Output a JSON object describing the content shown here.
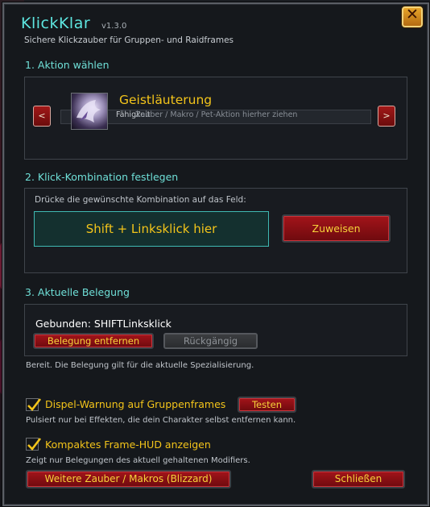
{
  "window": {
    "title": "KlickKlar",
    "version": "v1.3.0",
    "subtitle": "Sichere Klickzauber für Gruppen- und Raidframes",
    "close_label": "✕"
  },
  "section1": {
    "heading": "1. Aktion wählen",
    "prev_label": "<",
    "next_label": ">",
    "spell_name": "Geistläuterung",
    "spell_sub": "Fähigkeit",
    "drop_hint": "Zauber / Makro / Pet-Aktion hierher ziehen",
    "spell_icon": "spell-icon"
  },
  "section2": {
    "heading": "2. Klick-Kombination festlegen",
    "instruction": "Drücke die gewünschte Kombination auf das Feld:",
    "combo_field": "Shift + Linksklick hier",
    "assign_label": "Zuweisen"
  },
  "section3": {
    "heading": "3. Aktuelle Belegung",
    "bound_text": "Gebunden: SHIFTLinksklick",
    "remove_label": "Belegung entfernen",
    "undo_label": "Rückgängig"
  },
  "status_text": "Bereit. Die Belegung gilt für die aktuelle Spezialisierung.",
  "options": {
    "dispel": {
      "label": "Dispel-Warnung auf Gruppenframes",
      "checked": true,
      "test_label": "Testen",
      "description": "Pulsiert nur bei Effekten, die dein Charakter selbst entfernen kann."
    },
    "hud": {
      "label": "Kompaktes Frame-HUD anzeigen",
      "checked": true,
      "description": "Zeigt nur Belegungen des aktuell gehaltenen Modifiers."
    }
  },
  "footer": {
    "more_label": "Weitere Zauber / Makros (Blizzard)",
    "close_label": "Schließen"
  },
  "colors": {
    "accent_teal": "#6fe0d8",
    "gold_text": "#f3c41a",
    "red_button": "#8a1014"
  }
}
